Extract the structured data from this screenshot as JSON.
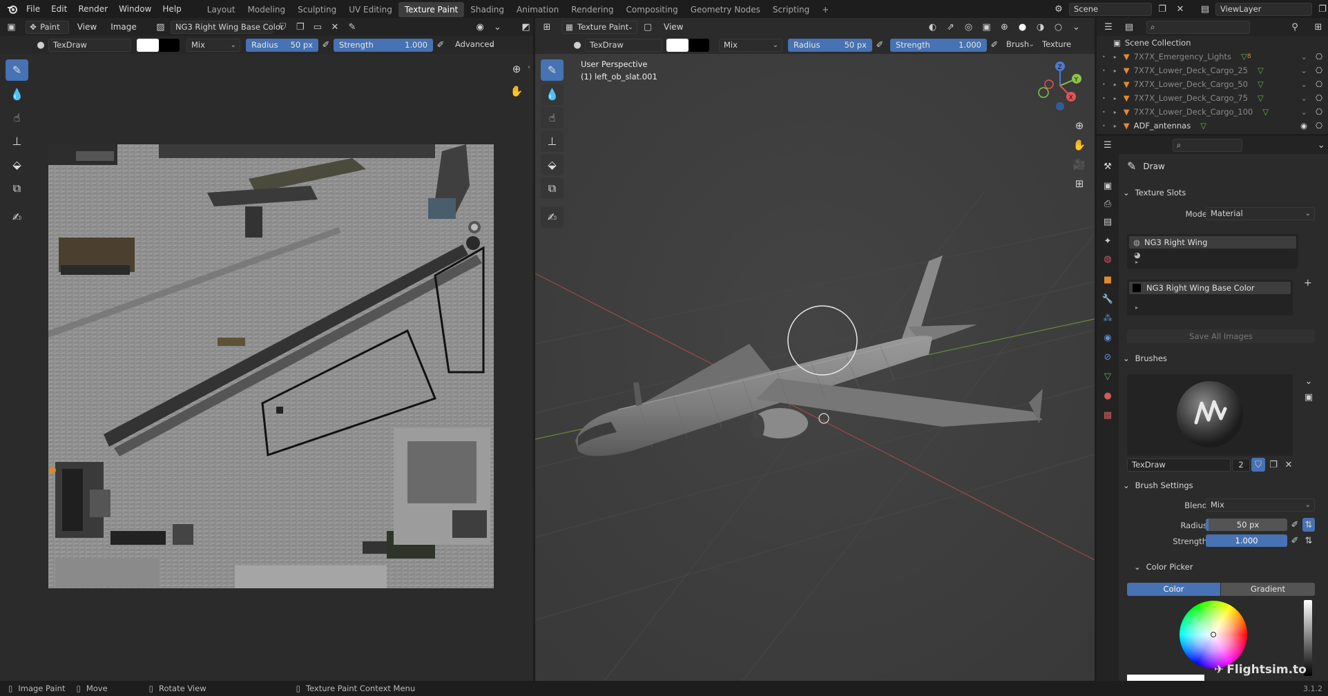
{
  "topbar": {
    "menus": [
      "File",
      "Edit",
      "Render",
      "Window",
      "Help"
    ],
    "workspaces": [
      "Layout",
      "Modeling",
      "Sculpting",
      "UV Editing",
      "Texture Paint",
      "Shading",
      "Animation",
      "Rendering",
      "Compositing",
      "Geometry Nodes",
      "Scripting"
    ],
    "active_workspace": "Texture Paint",
    "add_tab": "+",
    "scene_name": "Scene",
    "view_layer": "ViewLayer"
  },
  "image_editor": {
    "mode": "Paint",
    "menus": [
      "View",
      "Image"
    ],
    "image_name": "NG3 Right Wing Base Color",
    "brush_name": "TexDraw",
    "blend": "Mix",
    "radius_label": "Radius",
    "radius_value": "50 px",
    "strength_label": "Strength",
    "strength_value": "1.000",
    "advanced": "Advanced"
  },
  "viewport": {
    "mode": "Texture Paint",
    "menu": "View",
    "brush_name": "TexDraw",
    "blend": "Mix",
    "radius_label": "Radius",
    "radius_value": "50 px",
    "strength_label": "Strength",
    "strength_value": "1.000",
    "brush_menu": "Brush",
    "texture_menu": "Texture",
    "perspective": "User Perspective",
    "object": "(1) left_ob_slat.001",
    "gizmo_axes": [
      "Z",
      "Y",
      "X"
    ]
  },
  "outliner": {
    "root": "Scene Collection",
    "items": [
      {
        "name": "7X7X_Emergency_Lights",
        "extra": "8",
        "dim": true
      },
      {
        "name": "7X7X_Lower_Deck_Cargo_25",
        "extra": "",
        "dim": true
      },
      {
        "name": "7X7X_Lower_Deck_Cargo_50",
        "extra": "",
        "dim": true
      },
      {
        "name": "7X7X_Lower_Deck_Cargo_75",
        "extra": "",
        "dim": true
      },
      {
        "name": "7X7X_Lower_Deck_Cargo_100",
        "extra": "",
        "dim": true
      },
      {
        "name": "ADF_antennas",
        "extra": "",
        "dim": false
      }
    ]
  },
  "properties": {
    "tool_name": "Draw",
    "texture_slots": {
      "title": "Texture Slots",
      "mode_label": "Mode",
      "mode_value": "Material",
      "material": "NG3 Right Wing",
      "image": "NG3 Right Wing Base Color",
      "add": "+",
      "save_all": "Save All Images"
    },
    "brushes": {
      "title": "Brushes",
      "name": "TexDraw",
      "users": "2"
    },
    "brush_settings": {
      "title": "Brush Settings",
      "blend_label": "Blend",
      "blend_value": "Mix",
      "radius_label": "Radius",
      "radius_value": "50 px",
      "strength_label": "Strength",
      "strength_value": "1.000"
    },
    "color_picker": {
      "title": "Color Picker",
      "tabs": [
        "Color",
        "Gradient"
      ],
      "active_tab": "Color"
    }
  },
  "statusbar": {
    "items": [
      "Image Paint",
      "Move",
      "Rotate View",
      "Texture Paint Context Menu"
    ],
    "version": "3.1.2"
  },
  "watermark": "Flightsim.to",
  "colors": {
    "accent": "#4772b3",
    "panel_bg": "#282828",
    "header_bg": "#232323",
    "viewport_bg": "#3d3d3d"
  }
}
